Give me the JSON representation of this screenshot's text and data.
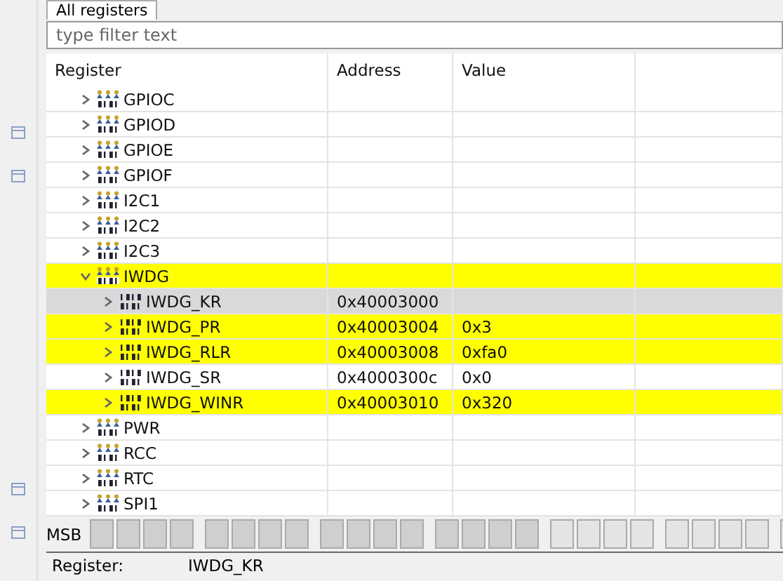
{
  "tab": {
    "label": "All registers",
    "selected": true
  },
  "filter": {
    "placeholder": "type filter text"
  },
  "table": {
    "columns": [
      "Register",
      "Address",
      "Value"
    ],
    "rows": [
      {
        "name": "GPIOC",
        "expanded": false,
        "highlighted": false,
        "selected": false
      },
      {
        "name": "GPIOD",
        "expanded": false,
        "highlighted": false,
        "selected": false
      },
      {
        "name": "GPIOE",
        "expanded": false,
        "highlighted": false,
        "selected": false
      },
      {
        "name": "GPIOF",
        "expanded": false,
        "highlighted": false,
        "selected": false
      },
      {
        "name": "I2C1",
        "expanded": false,
        "highlighted": false,
        "selected": false
      },
      {
        "name": "I2C2",
        "expanded": false,
        "highlighted": false,
        "selected": false
      },
      {
        "name": "I2C3",
        "expanded": false,
        "highlighted": false,
        "selected": false
      },
      {
        "name": "IWDG",
        "expanded": true,
        "highlighted": true,
        "selected": false,
        "children": [
          {
            "name": "IWDG_KR",
            "address": "0x40003000",
            "highlighted": false,
            "selected": true
          },
          {
            "name": "IWDG_PR",
            "address": "0x40003004",
            "value": "0x3",
            "highlighted": true,
            "selected": false
          },
          {
            "name": "IWDG_RLR",
            "address": "0x40003008",
            "value": "0xfa0",
            "highlighted": true,
            "selected": false
          },
          {
            "name": "IWDG_SR",
            "address": "0x4000300c",
            "value": "0x0",
            "highlighted": false,
            "selected": false
          },
          {
            "name": "IWDG_WINR",
            "address": "0x40003010",
            "value": "0x320",
            "highlighted": true,
            "selected": false
          }
        ]
      },
      {
        "name": "PWR",
        "expanded": false,
        "highlighted": false,
        "selected": false
      },
      {
        "name": "RCC",
        "expanded": false,
        "highlighted": false,
        "selected": false
      },
      {
        "name": "RTC",
        "expanded": false,
        "highlighted": false,
        "selected": false
      },
      {
        "name": "SPI1",
        "expanded": false,
        "highlighted": false,
        "selected": false
      }
    ]
  },
  "bits": {
    "label": "MSB",
    "cells": [
      {
        "kind": "reserved"
      },
      {
        "kind": "reserved"
      },
      {
        "kind": "reserved"
      },
      {
        "kind": "reserved"
      },
      {
        "kind": "reserved"
      },
      {
        "kind": "reserved"
      },
      {
        "kind": "reserved"
      },
      {
        "kind": "reserved"
      },
      {
        "kind": "reserved"
      },
      {
        "kind": "reserved"
      },
      {
        "kind": "reserved"
      },
      {
        "kind": "reserved"
      },
      {
        "kind": "reserved"
      },
      {
        "kind": "reserved"
      },
      {
        "kind": "reserved"
      },
      {
        "kind": "reserved"
      },
      {
        "kind": "bit"
      },
      {
        "kind": "bit"
      },
      {
        "kind": "bit"
      },
      {
        "kind": "bit"
      },
      {
        "kind": "bit"
      },
      {
        "kind": "bit"
      },
      {
        "kind": "bit"
      },
      {
        "kind": "bit"
      },
      {
        "kind": "bit"
      }
    ]
  },
  "details": {
    "label": "Register:",
    "value": "IWDG_KR"
  }
}
